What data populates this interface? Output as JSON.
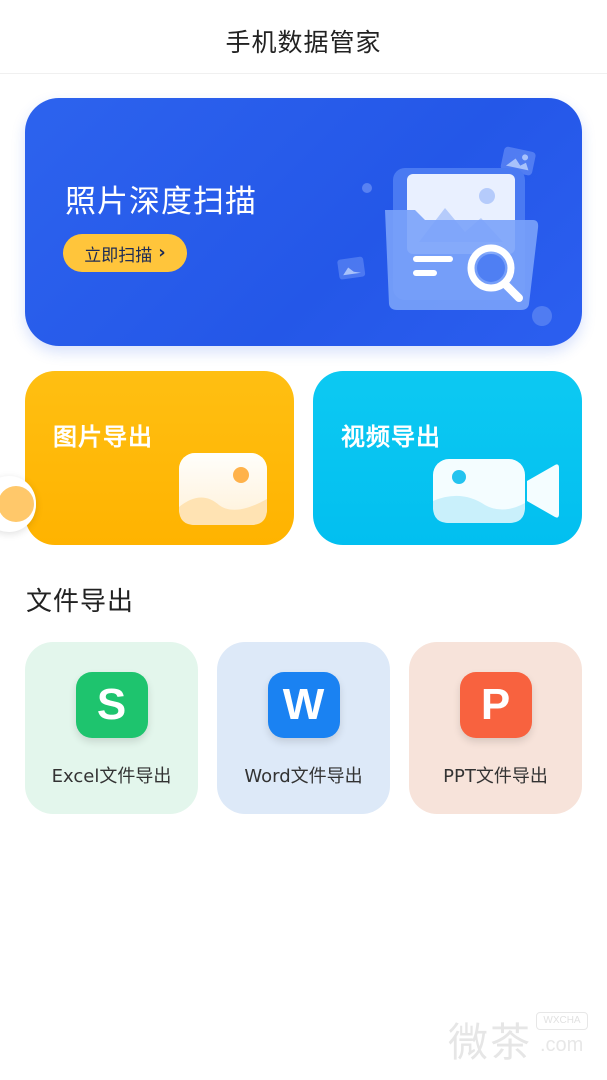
{
  "header": {
    "title": "手机数据管家"
  },
  "scan_card": {
    "title": "照片深度扫描",
    "button_label": "立即扫描",
    "button_chevron": "›"
  },
  "tiles": {
    "picture_export": {
      "label": "图片导出",
      "icon": "image-icon"
    },
    "video_export": {
      "label": "视频导出",
      "icon": "video-camera-icon"
    }
  },
  "file_section": {
    "title": "文件导出",
    "items": [
      {
        "label": "Excel文件导出",
        "glyph": "S",
        "icon": "excel-icon",
        "color": "#1ec46e"
      },
      {
        "label": "Word文件导出",
        "glyph": "W",
        "icon": "word-icon",
        "color": "#1a82f2"
      },
      {
        "label": "PPT文件导出",
        "glyph": "P",
        "icon": "ppt-icon",
        "color": "#f8623f"
      }
    ]
  },
  "watermark": {
    "cn": "微茶",
    "tag": "WXCHA",
    "domain": ".com"
  },
  "colors": {
    "scan_bg": "#2457e8",
    "button_yellow": "#ffc53b",
    "picture_tile": "#ffb300",
    "video_tile": "#02bff0"
  }
}
